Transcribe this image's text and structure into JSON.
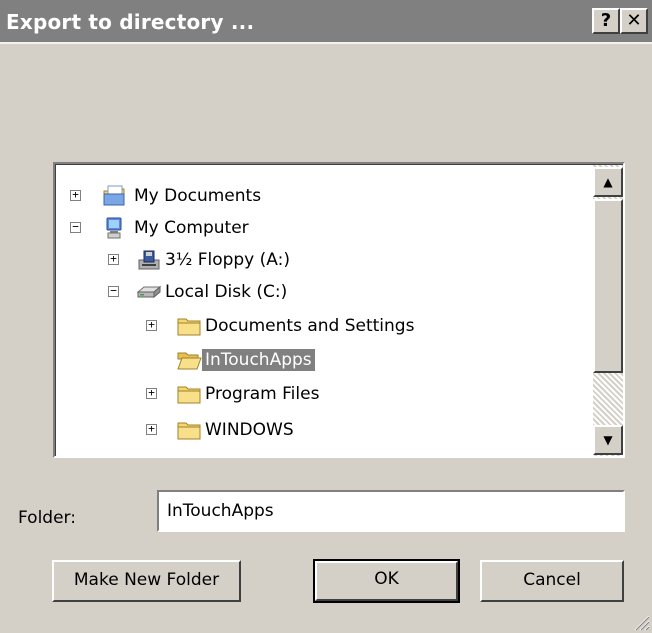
{
  "dialog": {
    "title": "Export to directory ...",
    "help_label": "?",
    "close_label": "✕"
  },
  "tree": {
    "items": [
      {
        "label": "My Documents",
        "expander": "+",
        "icon": "my-documents-icon",
        "level": 0
      },
      {
        "label": "My Computer",
        "expander": "−",
        "icon": "my-computer-icon",
        "level": 0
      },
      {
        "label": "3½ Floppy (A:)",
        "expander": "+",
        "icon": "floppy-drive-icon",
        "level": 1
      },
      {
        "label": "Local Disk (C:)",
        "expander": "−",
        "icon": "hard-drive-icon",
        "level": 1
      },
      {
        "label": "Documents and Settings",
        "expander": "+",
        "icon": "folder-icon",
        "level": 2
      },
      {
        "label": "InTouchApps",
        "expander": "",
        "icon": "open-folder-icon",
        "level": 2,
        "selected": true
      },
      {
        "label": "Program Files",
        "expander": "+",
        "icon": "folder-icon",
        "level": 2
      },
      {
        "label": "WINDOWS",
        "expander": "+",
        "icon": "folder-icon",
        "level": 2
      }
    ]
  },
  "scrollbar": {
    "up_arrow": "▲",
    "down_arrow": "▼"
  },
  "folder": {
    "label": "Folder:",
    "value": "InTouchApps"
  },
  "buttons": {
    "make_new_folder": "Make New Folder",
    "ok": "OK",
    "cancel": "Cancel"
  },
  "colors": {
    "titlebar": "#808080",
    "dialog_bg": "#d4d0c8",
    "selection": "#808080",
    "folder_yellow": "#f5d76e"
  }
}
